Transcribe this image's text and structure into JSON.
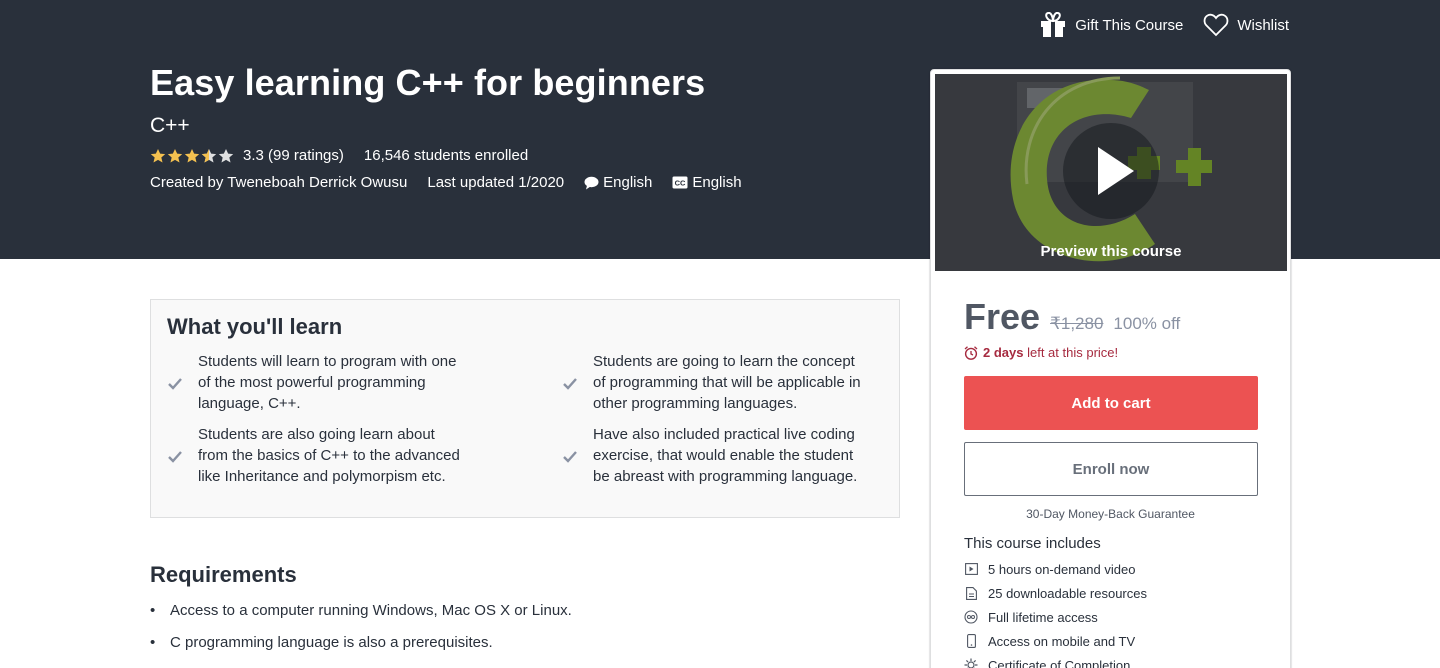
{
  "header": {
    "gift_label": "Gift This Course",
    "wishlist_label": "Wishlist",
    "title": "Easy learning C++ for beginners",
    "subtitle": "C++",
    "rating_value": 3.3,
    "rating_text": "3.3 (99 ratings)",
    "enrolled_text": "16,546 students enrolled",
    "created_by": "Created by Tweneboah Derrick Owusu",
    "last_updated": "Last updated 1/2020",
    "language": "English",
    "captions": "English"
  },
  "sidebar": {
    "preview_label": "Preview this course",
    "price": "Free",
    "original_price": "₹1,280",
    "discount": "100% off",
    "timer_bold": "2 days",
    "timer_rest": " left at this price!",
    "add_to_cart_label": "Add to cart",
    "enroll_label": "Enroll now",
    "guarantee": "30-Day Money-Back Guarantee",
    "includes_title": "This course includes",
    "includes": [
      {
        "icon": "video-icon",
        "label": "5 hours on-demand video"
      },
      {
        "icon": "file-icon",
        "label": "25 downloadable resources"
      },
      {
        "icon": "infinity-icon",
        "label": "Full lifetime access"
      },
      {
        "icon": "mobile-icon",
        "label": "Access on mobile and TV"
      },
      {
        "icon": "certificate-icon",
        "label": "Certificate of Completion"
      }
    ],
    "colors": {
      "cart_button": "#ec5252",
      "timer": "#a62a3f",
      "header_bg": "#29303b"
    }
  },
  "learn": {
    "title": "What you'll learn",
    "items": [
      "Students will learn to program with one of the most powerful programming language, C++.",
      "Students are going to learn the concept of programming that will be applicable in other programming languages.",
      "Students are also going learn about from the basics of C++ to the advanced like Inheritance and polymorpism etc.",
      "Have also included practical live coding exercise, that would enable the student be abreast with programming language."
    ]
  },
  "requirements": {
    "title": "Requirements",
    "items": [
      "Access to a computer running Windows, Mac OS X or Linux.",
      "C programming language is also a prerequisites."
    ]
  }
}
